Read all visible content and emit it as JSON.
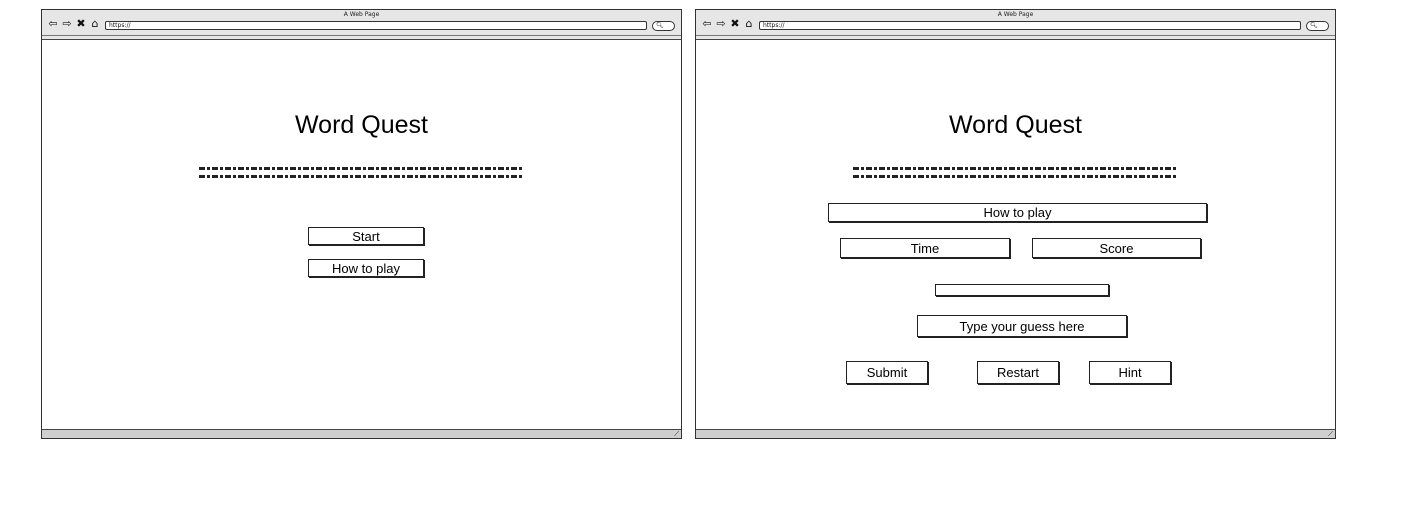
{
  "left_window": {
    "browser": {
      "title": "A Web Page",
      "url": "https://",
      "search_icon": "search-icon"
    },
    "page": {
      "title": "Word Quest",
      "start_label": "Start",
      "how_to_play_label": "How to play"
    }
  },
  "right_window": {
    "browser": {
      "title": "A Web Page",
      "url": "https://",
      "search_icon": "search-icon"
    },
    "page": {
      "title": "Word Quest",
      "how_to_play_label": "How to play",
      "time_label": "Time",
      "score_label": "Score",
      "guess_label": "Type your guess here",
      "submit_label": "Submit",
      "restart_label": "Restart",
      "hint_label": "Hint"
    }
  },
  "icons": {
    "back": "back-arrow-icon",
    "forward": "forward-arrow-icon",
    "stop": "close-icon",
    "home": "home-icon",
    "resize": "resize-grip-icon"
  }
}
